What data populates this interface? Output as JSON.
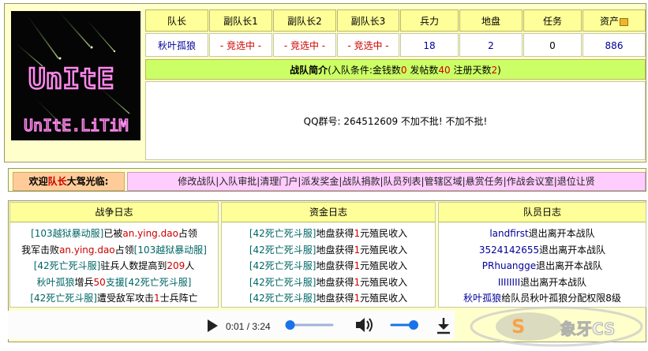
{
  "logo": {
    "line1": "UnItE",
    "line2": "UnItE.LiTiM"
  },
  "table": {
    "headers": [
      "队长",
      "副队长1",
      "副队长2",
      "副队长3",
      "兵力",
      "地盘",
      "任务",
      "资产"
    ],
    "values": [
      "秋叶孤狼",
      "- 竞选中 -",
      "- 竞选中 -",
      "- 竞选中 -",
      "18",
      "2",
      "0",
      "886"
    ]
  },
  "intro": {
    "title": "战队简介",
    "cond_prefix": "(入队条件:金钱数",
    "money": "0",
    "posts_label": " 发帖数",
    "posts": "40",
    "days_label": " 注册天数",
    "days": "2",
    "cond_suffix": ")",
    "body": "QQ群号: 264512609 不加不批! 不加不批!"
  },
  "nav": {
    "welcome_prefix": "欢迎",
    "welcome_role": "队长",
    "welcome_suffix": "大驾光临:",
    "links": [
      "修改战队",
      "入队审批",
      "清理门户",
      "派发奖金",
      "战队捐款",
      "队员列表",
      "管辖区域",
      "悬赏任务",
      "作战会议室",
      "退位让贤"
    ]
  },
  "war_log": {
    "title": "战争日志",
    "lines": [
      {
        "a": "[103越狱暴动服]",
        "b": "已被",
        "c": "an.ying.dao",
        "d": "占领"
      },
      {
        "a": "我军击败",
        "b": "an.ying.dao",
        "c": "占领",
        "d": "[103越狱暴动服]"
      },
      {
        "a": "[42死亡死斗服]",
        "b": "驻兵人数提高到",
        "c": "209",
        "d": "人"
      },
      {
        "a": "秋叶孤狼",
        "b": "增兵",
        "c": "50",
        "d": "支援[42死亡死斗服]"
      },
      {
        "a": "[42死亡死斗服]",
        "b": "遭受敌军攻击",
        "c": "1",
        "d": "士兵阵亡"
      }
    ]
  },
  "fund_log": {
    "title": "资金日志",
    "lines": [
      {
        "a": "[42死亡死斗服]",
        "b": "地盘获得",
        "c": "1",
        "d": "元殖民收入"
      },
      {
        "a": "[42死亡死斗服]",
        "b": "地盘获得",
        "c": "1",
        "d": "元殖民收入"
      },
      {
        "a": "[42死亡死斗服]",
        "b": "地盘获得",
        "c": "1",
        "d": "元殖民收入"
      },
      {
        "a": "[42死亡死斗服]",
        "b": "地盘获得",
        "c": "1",
        "d": "元殖民收入"
      },
      {
        "a": "[42死亡死斗服]",
        "b": "地盘获得",
        "c": "1",
        "d": "元殖民收入"
      }
    ]
  },
  "member_log": {
    "title": "队员日志",
    "lines": [
      {
        "a": "landfirst",
        "b": "退出离开本战队"
      },
      {
        "a": "3524142655",
        "b": "退出离开本战队"
      },
      {
        "a": "PRhuangge",
        "b": "退出离开本战队"
      },
      {
        "a": "IIIIIIII",
        "b": "退出离开本战队"
      },
      {
        "a": "秋叶孤狼",
        "b": "给队员秋叶孤狼分配权限8级"
      }
    ]
  },
  "player": {
    "time": "0:01 / 3:24",
    "progress": 0.01,
    "volume": 0.8
  },
  "watermark": {
    "text": "象牙CS"
  }
}
